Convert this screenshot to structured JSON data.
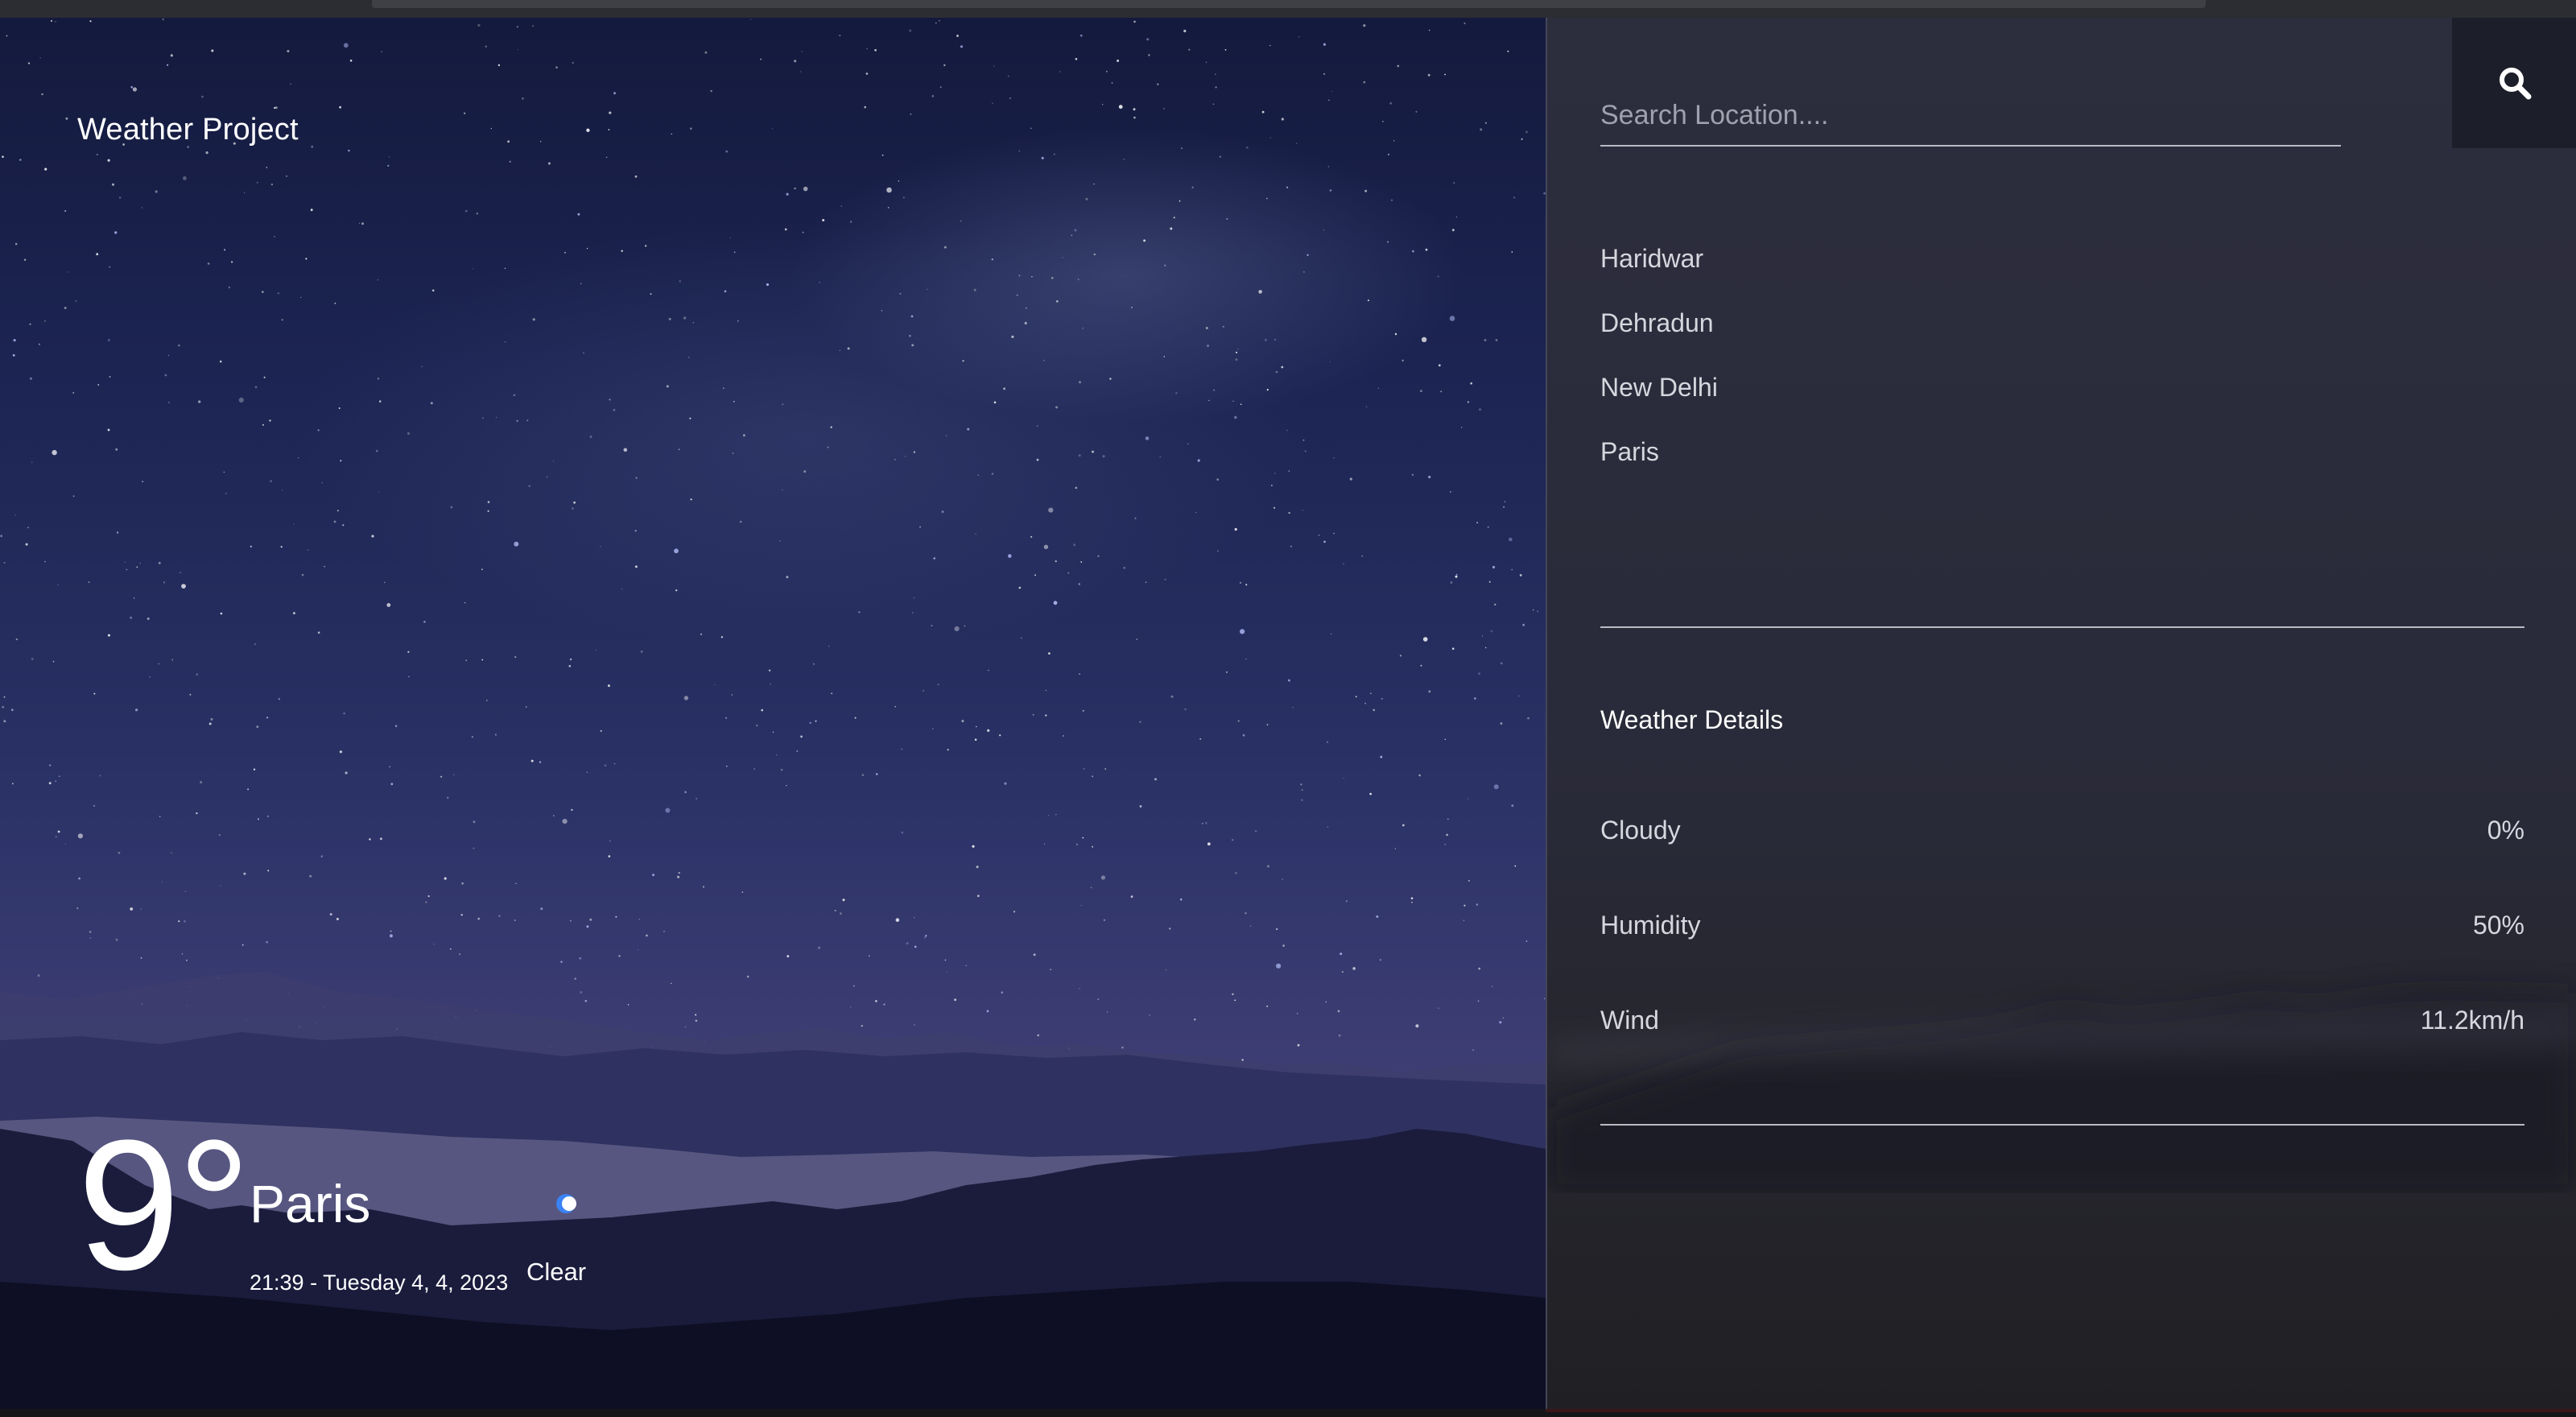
{
  "app": {
    "brand": "Weather Project"
  },
  "current": {
    "temperature": "9°",
    "city": "Paris",
    "datetime": "21:39 - Tuesday 4, 4, 2023",
    "condition": "Clear",
    "condition_icon": "moon-icon"
  },
  "search": {
    "placeholder": "Search Location....",
    "value": "",
    "button_icon": "search-icon"
  },
  "locations": [
    "Haridwar",
    "Dehradun",
    "New Delhi",
    "Paris"
  ],
  "details": {
    "title": "Weather Details",
    "rows": [
      {
        "label": "Cloudy",
        "value": "0%"
      },
      {
        "label": "Humidity",
        "value": "50%"
      },
      {
        "label": "Wind",
        "value": "11.2km/h"
      }
    ]
  },
  "colors": {
    "sky_top": "#141a3d",
    "sky_horizon": "#4a4679",
    "panel_bg": "#2d2e3e",
    "search_button_bg": "#1c1f2a",
    "moon_accent": "#3b82f6"
  }
}
